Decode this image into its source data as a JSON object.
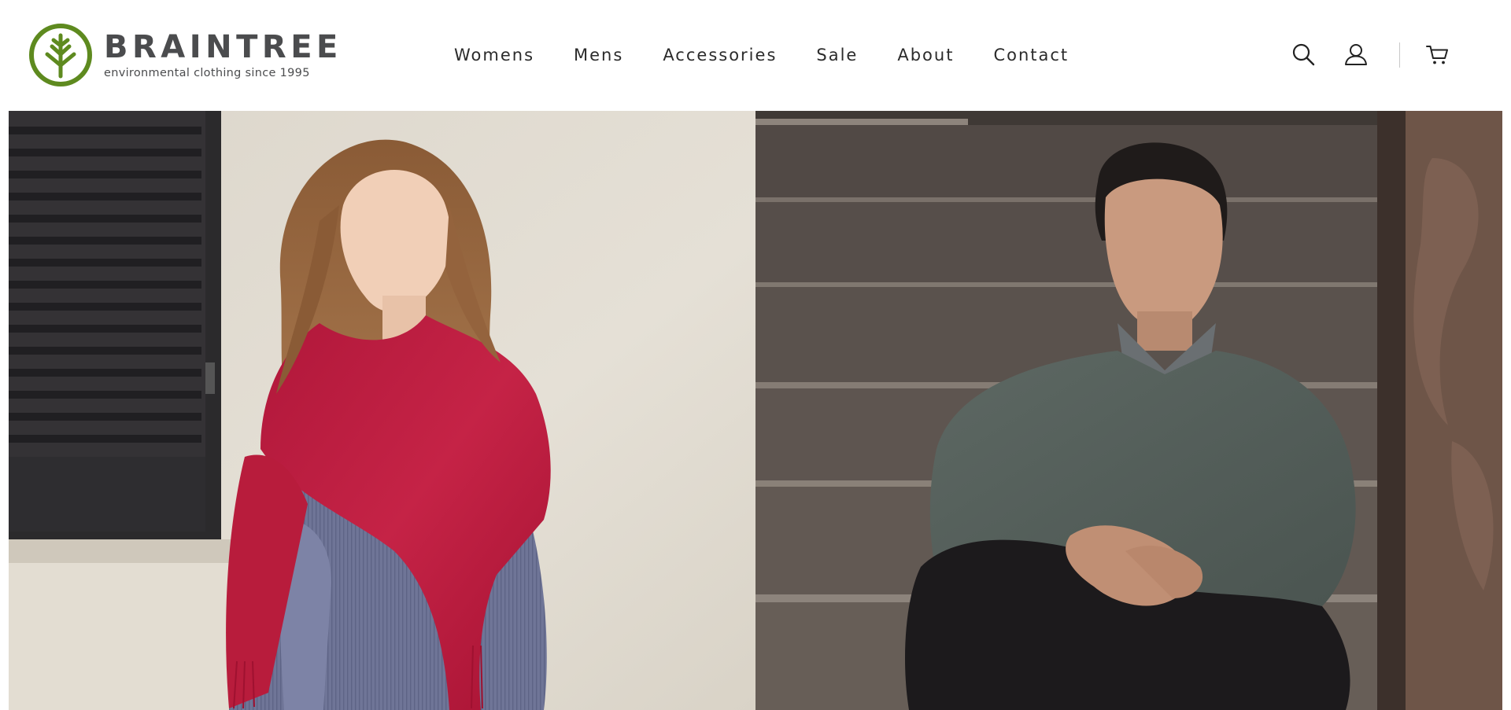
{
  "brand": {
    "name": "BRAINTREE",
    "tagline": "environmental clothing since 1995",
    "logo_icon": "tree-circle-logo",
    "color": "#5e8a1f"
  },
  "nav": {
    "items": [
      {
        "label": "Womens"
      },
      {
        "label": "Mens"
      },
      {
        "label": "Accessories"
      },
      {
        "label": "Sale"
      },
      {
        "label": "About"
      },
      {
        "label": "Contact"
      }
    ]
  },
  "tools": {
    "search_icon": "search-icon",
    "account_icon": "user-icon",
    "cart_icon": "cart-icon"
  },
  "hero": {
    "panels": [
      {
        "name": "womens",
        "subject": "woman-red-scarf"
      },
      {
        "name": "mens",
        "subject": "man-grey-sweater"
      }
    ]
  }
}
